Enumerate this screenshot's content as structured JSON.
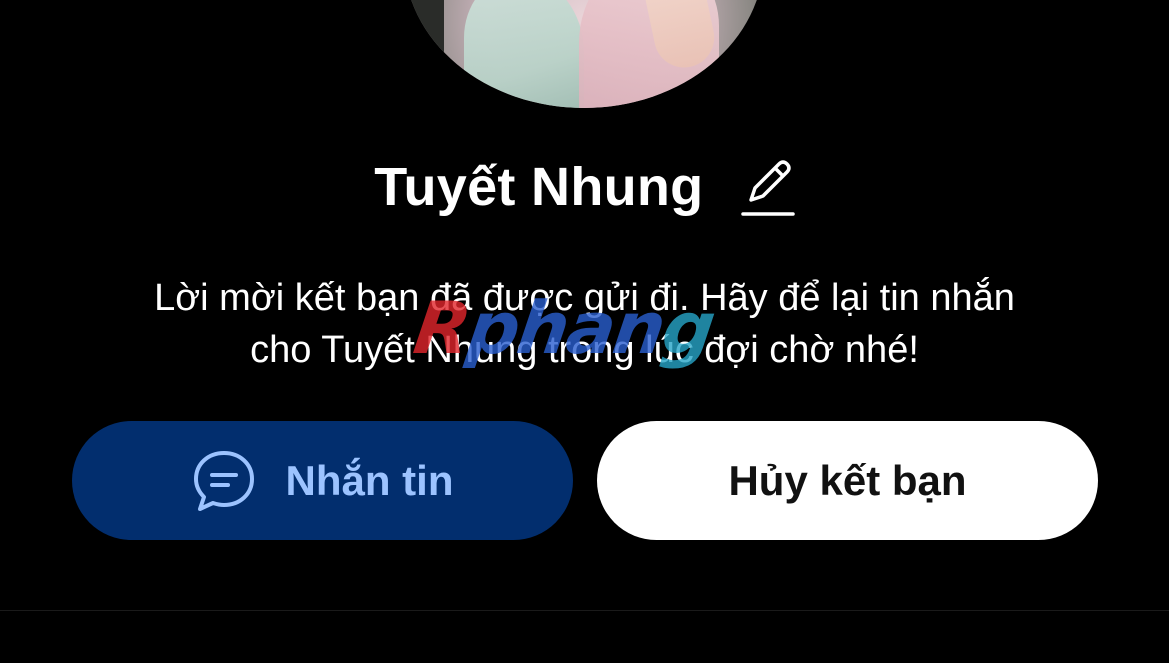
{
  "profile": {
    "name": "Tuyết Nhung",
    "avatar_alt": "profile-photo"
  },
  "notice": {
    "line1": "Lời mời kết bạn đã được gửi đi. Hãy để lại tin nhắn",
    "line2": "cho Tuyết Nhung trong lúc đợi chờ nhé!"
  },
  "actions": {
    "message_label": "Nhắn tin",
    "unfriend_label": "Hủy kết bạn"
  },
  "watermark": {
    "part1": "R",
    "part2": "phan",
    "part3": "g"
  },
  "colors": {
    "background": "#000000",
    "message_button_bg": "#022e6e",
    "message_button_text": "#9cc3ff",
    "unfriend_button_bg": "#ffffff",
    "unfriend_button_text": "#111111"
  },
  "icons": {
    "edit": "pencil-icon",
    "message": "chat-bubble-icon"
  }
}
